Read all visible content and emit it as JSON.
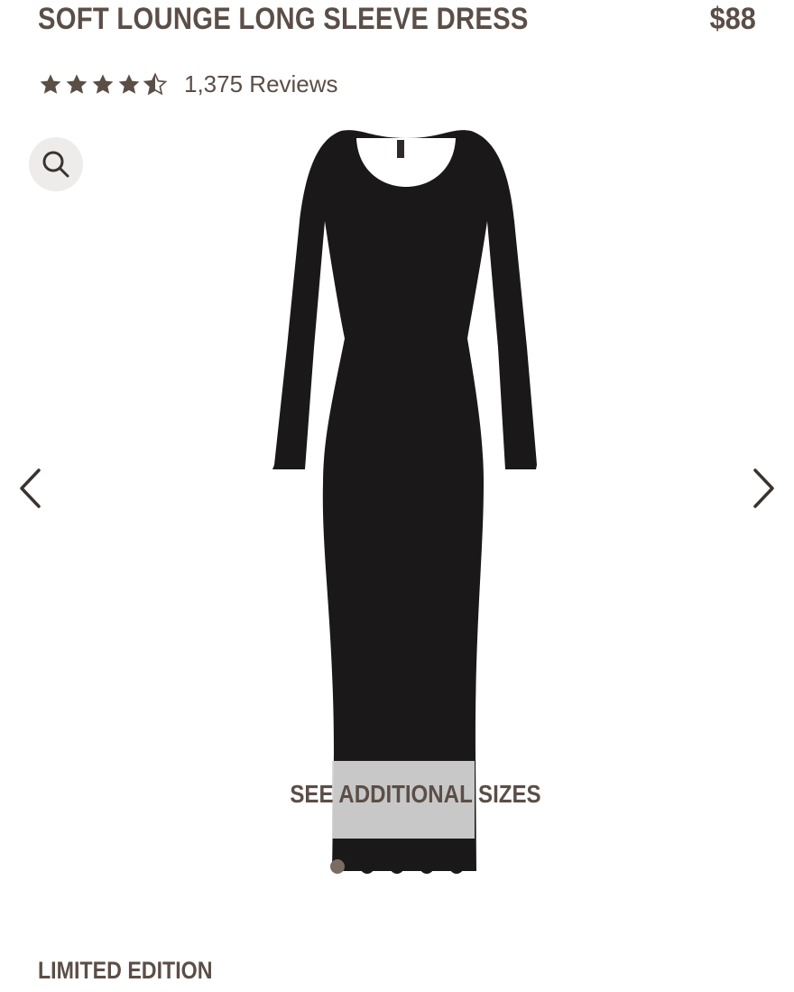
{
  "product": {
    "title": "SOFT LOUNGE LONG SLEEVE DRESS",
    "price": "$88",
    "rating": 4.5,
    "rating_max": 5,
    "reviews_text": "1,375 Reviews"
  },
  "gallery": {
    "zoom_icon": "magnifier-icon",
    "prev_icon": "chevron-left-icon",
    "next_icon": "chevron-right-icon",
    "image_subject": "black long sleeve scoop neck maxi dress",
    "see_sizes_label": "SEE ADDITIONAL SIZES",
    "dot_count": 5,
    "active_dot": 1
  },
  "badge": {
    "label": "LIMITED EDITION"
  },
  "colors": {
    "text": "#5b4e47",
    "dress": "#1a1818",
    "overlay": "#d6d6d6",
    "active_dot": "#7a6c63"
  }
}
